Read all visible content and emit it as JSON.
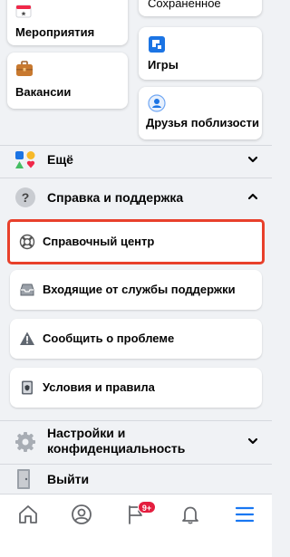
{
  "shortcuts": {
    "events_label": "Мероприятия",
    "saved_label": "Сохраненное",
    "jobs_label": "Вакансии",
    "games_label": "Игры",
    "nearby_label": "Друзья поблизости"
  },
  "sections": {
    "more_label": "Ещё",
    "help_label": "Справка и поддержка",
    "settings_label_line1": "Настройки и",
    "settings_label_line2": "конфиденциальность",
    "logout_label": "Выйти"
  },
  "help_items": [
    {
      "label": "Справочный центр"
    },
    {
      "label": "Входящие от службы поддержки"
    },
    {
      "label": "Сообщить о проблеме"
    },
    {
      "label": "Условия и правила"
    }
  ],
  "tabbar": {
    "notifications_badge": "9+"
  },
  "colors": {
    "accent": "#1877f2",
    "highlight_border": "#e8402b",
    "badge": "#e41e3f"
  }
}
